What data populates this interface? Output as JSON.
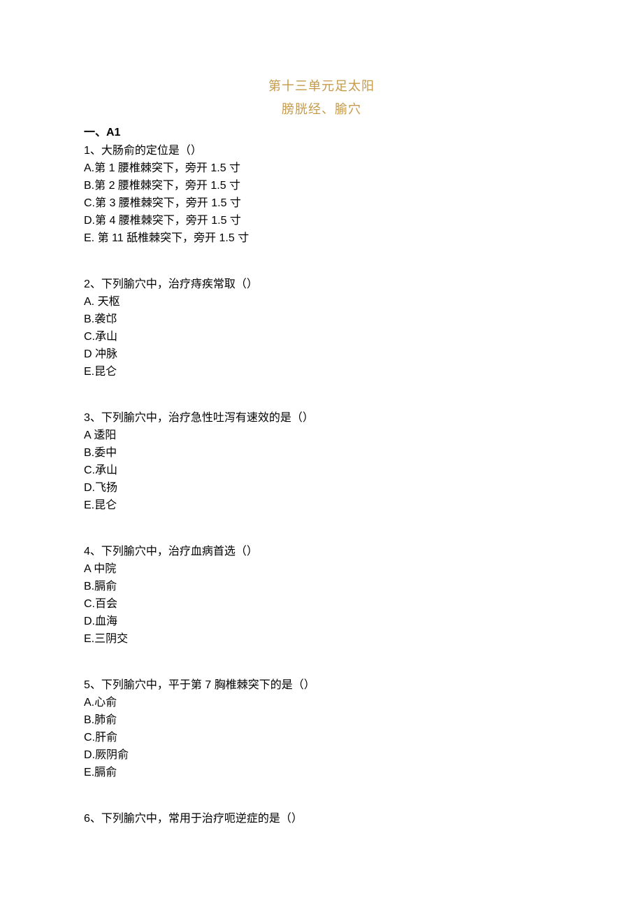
{
  "title_line1": "第十三单元足太阳",
  "title_line2": "膀胱经、腧穴",
  "section_label": "一、A1",
  "questions": [
    {
      "stem": "1、大肠俞的定位是（）",
      "options": [
        "A.第 1 腰椎棘突下，旁开 1.5 寸",
        "B.第 2 腰椎棘突下，旁开 1.5 寸",
        "C.第 3 腰椎棘突下，旁开 1.5 寸",
        "D.第 4 腰椎棘突下，旁开 1.5 寸",
        "E. 第 11 舐椎棘突下，旁开 1.5 寸"
      ]
    },
    {
      "stem": "2、下列腧穴中，治疗痔疾常取（）",
      "options": [
        "A. 天枢",
        "B.袭邙",
        "C.承山",
        "D 冲脉",
        "E.昆仑"
      ]
    },
    {
      "stem": "3、下列腧穴中，治疗急性吐泻有速效的是（）",
      "options": [
        "A 逶阳",
        "B.委中",
        "C.承山",
        "D.飞扬",
        "E.昆仑"
      ]
    },
    {
      "stem": "4、下列腧穴中，治疗血病首选（）",
      "options": [
        "A 中院",
        "B.膈俞",
        "C.百会",
        "D.血海",
        "E.三阴交"
      ]
    },
    {
      "stem": "5、下列腧穴中，平于第 7 胸椎棘突下的是（）",
      "options": [
        "A.心俞",
        "B.肺俞",
        "C.肝俞",
        "D.厥阴俞",
        "E.膈俞"
      ]
    },
    {
      "stem": "6、下列腧穴中，常用于治疗呃逆症的是（）",
      "options": []
    }
  ]
}
